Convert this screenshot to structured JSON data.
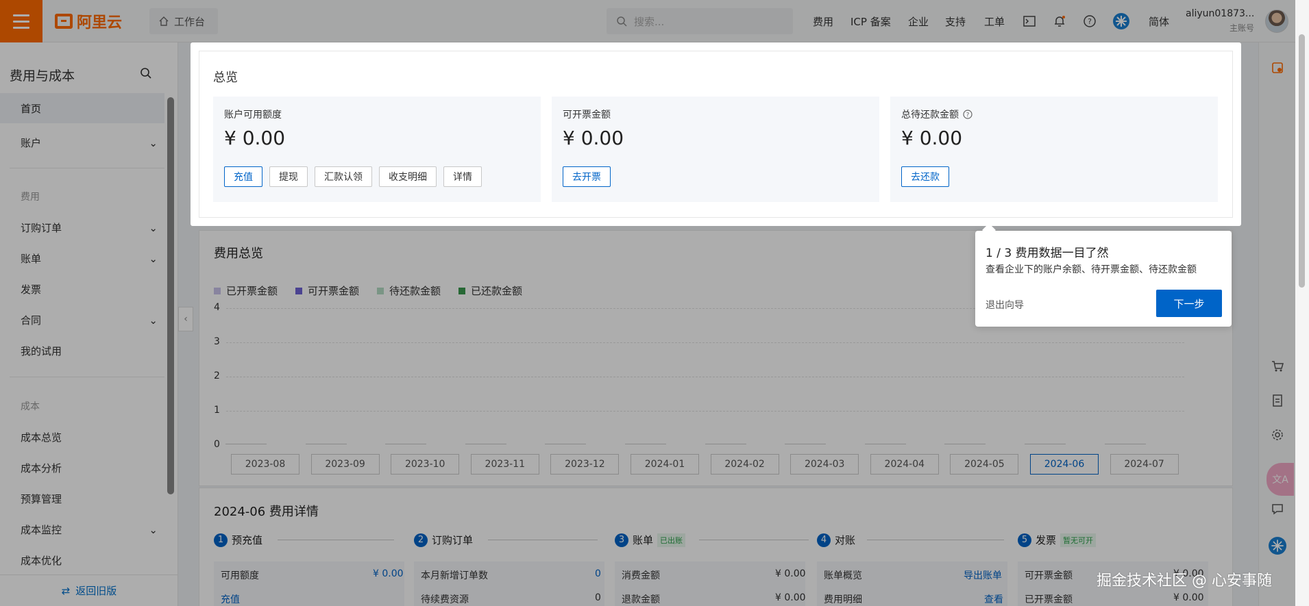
{
  "topbar": {
    "brand": "阿里云",
    "workbench": "工作台",
    "search_placeholder": "搜索...",
    "nav": [
      "费用",
      "ICP 备案",
      "企业",
      "支持",
      "工单"
    ],
    "lang": "简体",
    "user_name": "aliyun01873...",
    "user_role": "主账号"
  },
  "sidebar": {
    "title": "费用与成本",
    "items": [
      {
        "label": "首页"
      },
      {
        "label": "账户"
      },
      {
        "label": "费用"
      },
      {
        "label": "订购订单"
      },
      {
        "label": "账单"
      },
      {
        "label": "发票"
      },
      {
        "label": "合同"
      },
      {
        "label": "我的试用"
      },
      {
        "label": "成本"
      },
      {
        "label": "成本总览"
      },
      {
        "label": "成本分析"
      },
      {
        "label": "预算管理"
      },
      {
        "label": "成本监控"
      },
      {
        "label": "成本优化"
      }
    ],
    "back_label": "返回旧版"
  },
  "overview": {
    "title": "总览",
    "cards": [
      {
        "label": "账户可用额度",
        "amount": "¥ 0.00",
        "buttons": [
          "充值",
          "提现",
          "汇款认领",
          "收支明细",
          "详情"
        ]
      },
      {
        "label": "可开票金额",
        "amount": "¥ 0.00",
        "buttons": [
          "去开票"
        ]
      },
      {
        "label": "总待还款金额",
        "amount": "¥ 0.00",
        "buttons": [
          "去还款"
        ]
      }
    ]
  },
  "tour": {
    "title": "1 / 3 费用数据一目了然",
    "desc": "查看企业下的账户余额、待开票金额、待还款金额",
    "exit": "退出向导",
    "next": "下一步"
  },
  "cost_overview": {
    "title": "费用总览",
    "legend": [
      {
        "label": "已开票金额",
        "color": "#c9c3ea"
      },
      {
        "label": "可开票金额",
        "color": "#6f64d6"
      },
      {
        "label": "待还款金额",
        "color": "#b4dcc4"
      },
      {
        "label": "已还款金额",
        "color": "#3a9a4f"
      }
    ],
    "yticks": [
      "4",
      "3",
      "2",
      "1",
      "0"
    ],
    "months": [
      "2023-08",
      "2023-09",
      "2023-10",
      "2023-11",
      "2023-12",
      "2024-01",
      "2024-02",
      "2024-03",
      "2024-04",
      "2024-05",
      "2024-06",
      "2024-07"
    ],
    "selected_month": "2024-06"
  },
  "chart_data": {
    "type": "bar",
    "categories": [
      "2023-08",
      "2023-09",
      "2023-10",
      "2023-11",
      "2023-12",
      "2024-01",
      "2024-02",
      "2024-03",
      "2024-04",
      "2024-05",
      "2024-06",
      "2024-07"
    ],
    "series": [
      {
        "name": "已开票金额",
        "values": [
          0,
          0,
          0,
          0,
          0,
          0,
          0,
          0,
          0,
          0,
          0,
          0
        ]
      },
      {
        "name": "可开票金额",
        "values": [
          0,
          0,
          0,
          0,
          0,
          0,
          0,
          0,
          0,
          0,
          0,
          0
        ]
      },
      {
        "name": "待还款金额",
        "values": [
          0,
          0,
          0,
          0,
          0,
          0,
          0,
          0,
          0,
          0,
          0,
          0
        ]
      },
      {
        "name": "已还款金额",
        "values": [
          0,
          0,
          0,
          0,
          0,
          0,
          0,
          0,
          0,
          0,
          0,
          0
        ]
      }
    ],
    "ylim": [
      0,
      4
    ],
    "legend": "top-left"
  },
  "detail": {
    "title": "2024-06 费用详情",
    "steps": [
      {
        "num": "1",
        "label": "预充值",
        "tag": ""
      },
      {
        "num": "2",
        "label": "订购订单",
        "tag": ""
      },
      {
        "num": "3",
        "label": "账单",
        "tag": "已出账"
      },
      {
        "num": "4",
        "label": "对账",
        "tag": ""
      },
      {
        "num": "5",
        "label": "发票",
        "tag": "暂无可开"
      }
    ],
    "rows": {
      "c1r1": "可用额度",
      "c1v1": "¥ 0.00",
      "c1r2": "充值",
      "c2r1": "本月新增订单数",
      "c2v1": "0",
      "c2r2": "待续费资源",
      "c2v2": "0",
      "c3r1": "消费金额",
      "c3v1": "¥ 0.00",
      "c3r2": "退款金额",
      "c3v2": "¥ 0.00",
      "c4r1": "账单概览",
      "c4v1": "导出账单",
      "c4r2": "费用明细",
      "c4v2": "查看",
      "c5r1": "可开票金额",
      "c5v1": "¥ 0.00",
      "c5r2": "已开票金额",
      "c5v2": "¥ 0.00"
    }
  },
  "watermark": "掘金技术社区 @ 心安事随"
}
